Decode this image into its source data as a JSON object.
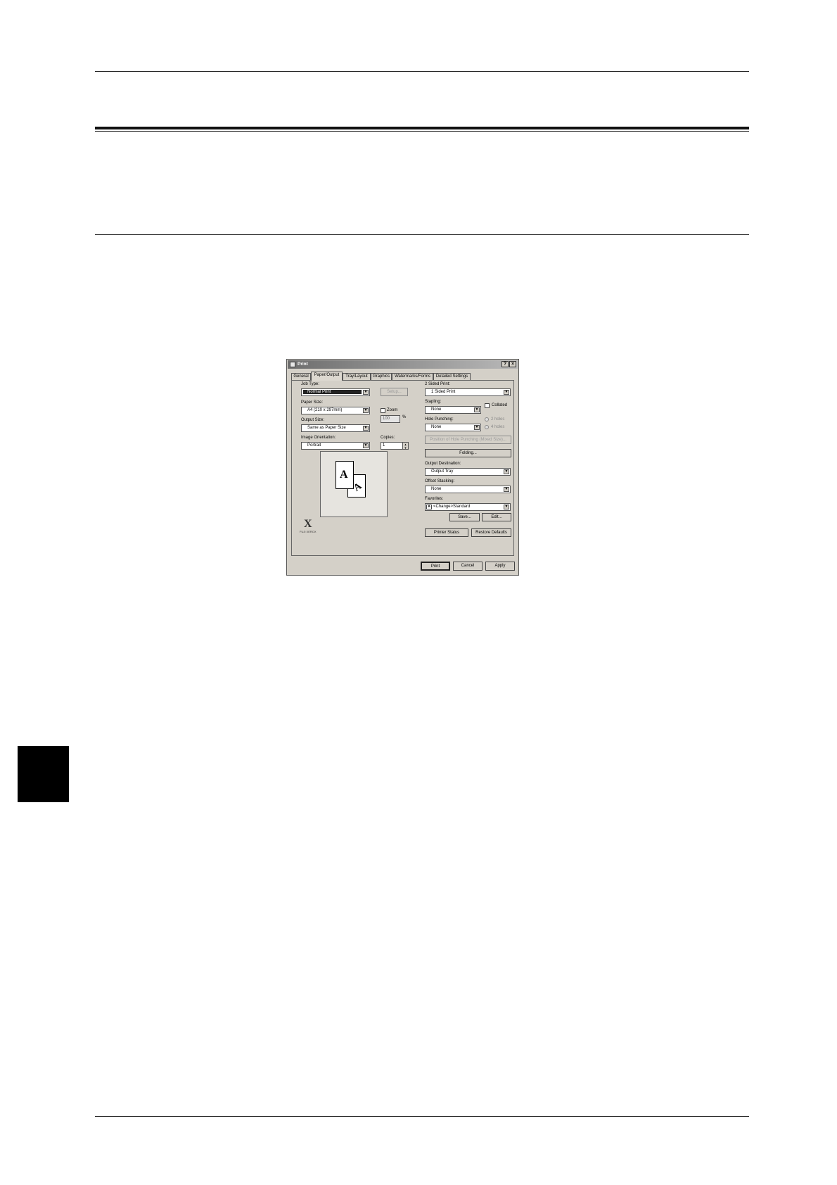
{
  "dialog": {
    "title": "Print",
    "help_btn": "?",
    "close_btn": "×",
    "tabs": [
      {
        "label": "General"
      },
      {
        "label": "Paper/Output"
      },
      {
        "label": "Tray/Layout"
      },
      {
        "label": "Graphics"
      },
      {
        "label": "Watermarks/Forms"
      },
      {
        "label": "Detailed Settings"
      }
    ],
    "active_tab": "Paper/Output",
    "left": {
      "job_type_label": "Job Type:",
      "job_type_value": "Normal Print",
      "setup_btn": "Setup...",
      "paper_size_label": "Paper Size:",
      "paper_size_value": "A4 (210 x 297mm)",
      "zoom_label": "Zoom",
      "zoom_value": "100",
      "zoom_unit": "%",
      "output_size_label": "Output Size:",
      "output_size_value": "Same as Paper Size",
      "orientation_label": "Image Orientation:",
      "orientation_value": "Portrait",
      "copies_label": "Copies:",
      "copies_value": "1",
      "spin_up": "▲",
      "spin_down": "▼",
      "preview_front_letter": "A",
      "preview_back_letter": "A",
      "logo_mark": "X",
      "logo_text": "FUJI XEROX"
    },
    "right": {
      "two_sided_label": "2 Sided Print:",
      "two_sided_value": "1 Sided Print",
      "stapling_label": "Stapling:",
      "stapling_value": "None",
      "collated_label": "Collated",
      "hole_punching_label": "Hole Punching:",
      "hole_punching_value": "None",
      "radio_1": "2 holes",
      "radio_2": "4 holes",
      "position_btn": "Position of Hole Punching (Mixed Size)...",
      "folding_btn": "Folding...",
      "output_dest_label": "Output Destination:",
      "output_dest_value": "Output Tray",
      "offset_label": "Offset Stacking:",
      "offset_value": "None",
      "favorites_label": "Favorites:",
      "favorites_value": "<Change>Standard",
      "favorites_icon": "A",
      "save_btn": "Save...",
      "edit_btn": "Edit...",
      "printer_status_btn": "Printer Status",
      "restore_btn": "Restore Defaults"
    },
    "footer": {
      "print_btn": "Print",
      "cancel_btn": "Cancel",
      "apply_btn": "Apply"
    },
    "arrow_glyph": "▼"
  }
}
